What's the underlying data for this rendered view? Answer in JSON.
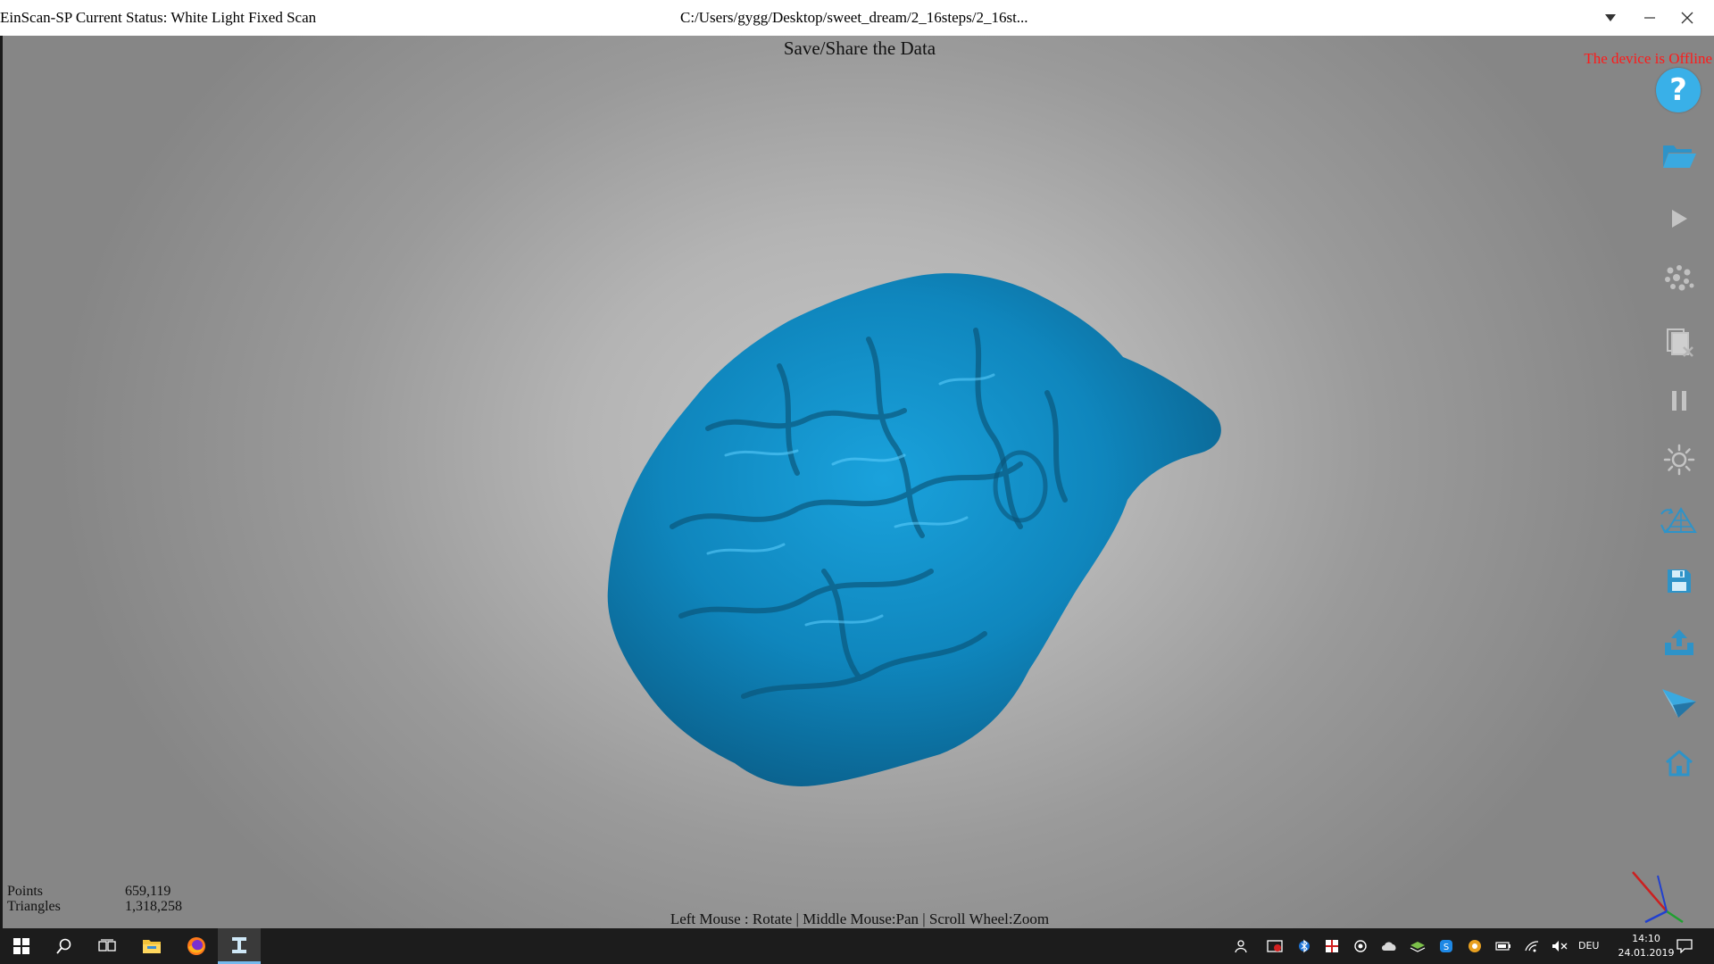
{
  "titlebar": {
    "status": "EinScan-SP Current Status: White Light Fixed Scan",
    "filepath": "C:/Users/gygg/Desktop/sweet_dream/2_16steps/2_16st..."
  },
  "viewport": {
    "title": "Save/Share the Data",
    "device_status": "The device is Offline",
    "hint": "Left Mouse : Rotate | Middle Mouse:Pan | Scroll Wheel:Zoom",
    "model_color": "#1a8fc4"
  },
  "stats": {
    "points_label": "Points",
    "points_value": "659,119",
    "triangles_label": "Triangles",
    "triangles_value": "1,318,258"
  },
  "toolbar": {
    "help_glyph": "?",
    "accent": "#39b0e8",
    "icons": [
      "help-icon",
      "open-folder-icon",
      "play-icon",
      "point-cloud-icon",
      "delete-data-icon",
      "pause-icon",
      "brightness-icon",
      "mesh-icon",
      "save-icon",
      "export-icon",
      "share-icon",
      "home-icon"
    ]
  },
  "taskbar": {
    "language": "DEU",
    "time": "14:10",
    "date": "24.01.2019"
  }
}
